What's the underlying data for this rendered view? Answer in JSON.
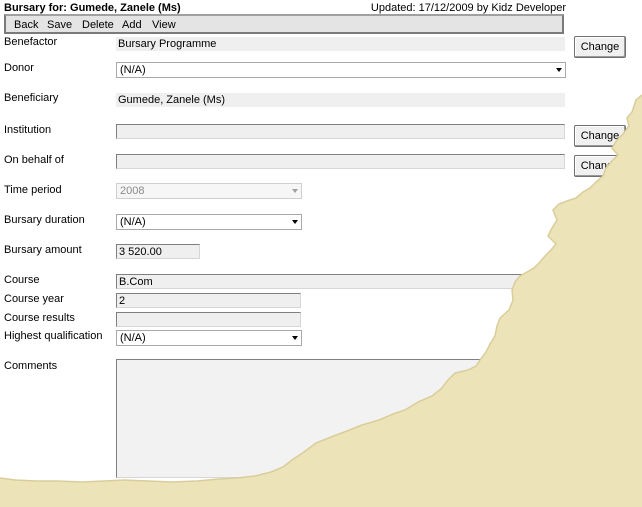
{
  "header": {
    "title": "Bursary for: Gumede, Zanele (Ms)",
    "updated": "Updated: 17/12/2009 by Kidz Developer"
  },
  "toolbar": {
    "items": [
      "Back",
      "Save",
      "Delete",
      "Add",
      "View"
    ]
  },
  "form": {
    "benefactor": {
      "label": "Benefactor",
      "value": "Bursary Programme",
      "button": "Change"
    },
    "donor": {
      "label": "Donor",
      "value": "(N/A)"
    },
    "beneficiary": {
      "label": "Beneficiary",
      "value": "Gumede, Zanele (Ms)"
    },
    "institution": {
      "label": "Institution",
      "value": "",
      "button": "Change"
    },
    "on_behalf_of": {
      "label": "On behalf of",
      "value": "",
      "button": "Change"
    },
    "time_period": {
      "label": "Time period",
      "value": "2008"
    },
    "bursary_duration": {
      "label": "Bursary duration",
      "value": "(N/A)"
    },
    "bursary_amount": {
      "label": "Bursary amount",
      "value": "3 520.00"
    },
    "course": {
      "label": "Course",
      "value": "B.Com"
    },
    "course_year": {
      "label": "Course year",
      "value": "2"
    },
    "course_results": {
      "label": "Course results",
      "value": ""
    },
    "highest_qualification": {
      "label": "Highest qualification",
      "value": "(N/A)"
    },
    "comments": {
      "label": "Comments",
      "value": ""
    }
  },
  "colors": {
    "torn_paper": "#ede3b9",
    "toolbar_bg": "#e4e4e4",
    "field_bg": "#efefef"
  }
}
